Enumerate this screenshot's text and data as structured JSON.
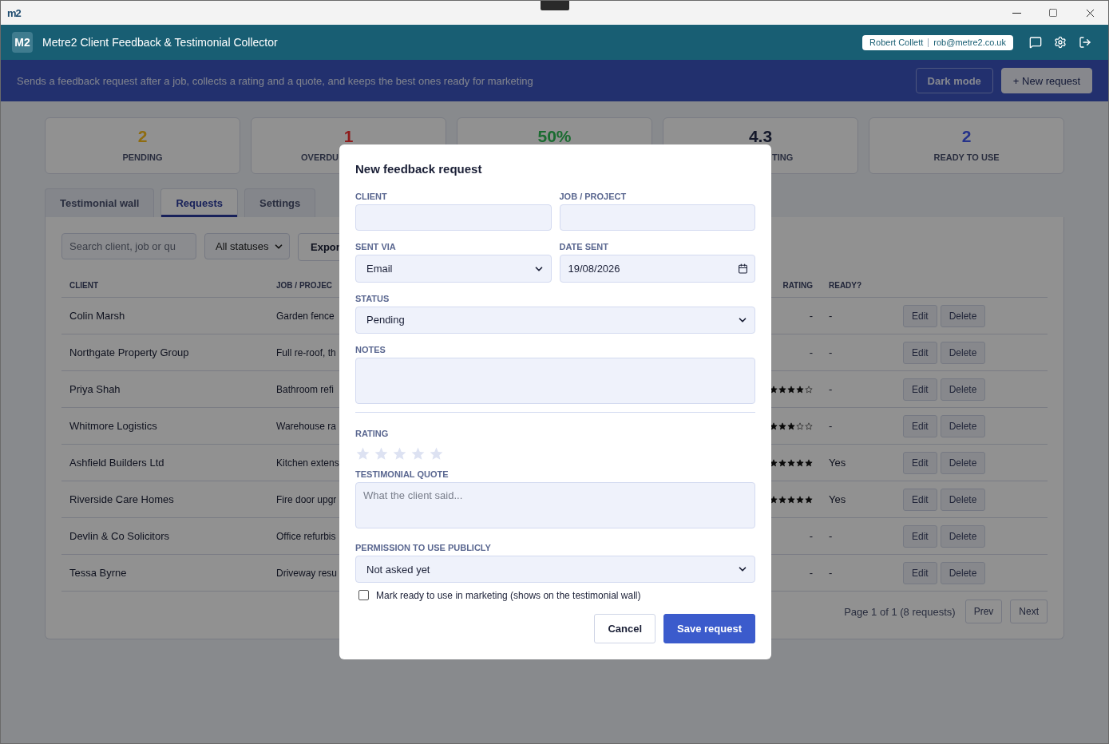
{
  "window": {
    "logo": "m2"
  },
  "header": {
    "logo": "M2",
    "title": "Metre2 Client Feedback & Testimonial Collector",
    "user": {
      "name": "Robert Collett",
      "email": "rob@metre2.co.uk"
    }
  },
  "banner": {
    "text": "Sends a feedback request after a job, collects a rating and a quote, and keeps the best ones ready for marketing",
    "buttons": [
      {
        "label": "Dark mode",
        "kind": "outline"
      },
      {
        "label": "+ New request",
        "kind": "primary"
      }
    ]
  },
  "stats": [
    {
      "value": "2",
      "label": "PENDING",
      "color": "#8f6c10"
    },
    {
      "value": "1",
      "label": "OVERDU",
      "color": "#8e1c1c"
    },
    {
      "value": "50%",
      "color": "#1a6b30"
    },
    {
      "value": "4.3",
      "label": "TING",
      "color": "#15192b"
    },
    {
      "value": "2",
      "label": "READY TO USE",
      "color": "#26338a"
    }
  ],
  "tabs": [
    {
      "label": "Testimonial wall",
      "selected": false
    },
    {
      "label": "Requests",
      "selected": true
    },
    {
      "label": "Settings",
      "selected": false
    }
  ],
  "toolbar": {
    "search_placeholder": "Search client, job or qu",
    "filter": "All statuses",
    "export": "Expor"
  },
  "table": {
    "columns": [
      "CLIENT",
      "JOB / PROJEC",
      "RATING",
      "READY?"
    ],
    "rows": [
      {
        "client": "Colin Marsh",
        "job": "Garden fence",
        "rating": "-",
        "ready": "-",
        "actions": [
          "Edit",
          "Delete"
        ]
      },
      {
        "client": "Northgate Property Group",
        "job": "Full re-roof, th",
        "rating": "-",
        "ready": "-",
        "actions": [
          "Edit",
          "Delete"
        ]
      },
      {
        "client": "Priya Shah",
        "job": "Bathroom refi",
        "stars": 4,
        "ready": "-",
        "actions": [
          "Edit",
          "Delete"
        ]
      },
      {
        "client": "Whitmore Logistics",
        "job": "Warehouse ra",
        "stars": 3,
        "ready": "-",
        "actions": [
          "Edit",
          "Delete"
        ]
      },
      {
        "client": "Ashfield Builders Ltd",
        "job": "Kitchen extens",
        "stars": 5,
        "ready": "Yes",
        "actions": [
          "Edit",
          "Delete"
        ]
      },
      {
        "client": "Riverside Care Homes",
        "job": "Fire door upgr",
        "stars": 5,
        "ready": "Yes",
        "actions": [
          "Edit",
          "Delete"
        ]
      },
      {
        "client": "Devlin & Co Solicitors",
        "job": "Office refurbis",
        "rating": "-",
        "ready": "-",
        "actions": [
          "Edit",
          "Delete"
        ]
      },
      {
        "client": "Tessa Byrne",
        "job": "Driveway resu",
        "rating": "-",
        "ready": "-",
        "actions": [
          "Edit",
          "Delete"
        ]
      }
    ]
  },
  "pagination": {
    "summary": "Page 1 of 1 (8 requests)",
    "prev": "Prev",
    "next": "Next"
  },
  "modal": {
    "title": "New feedback request",
    "client": {
      "label": "CLIENT"
    },
    "job": {
      "label": "JOB / PROJECT"
    },
    "sent_via": {
      "label": "SENT VIA",
      "value": "Email"
    },
    "date_sent": {
      "label": "DATE SENT",
      "value": "19/08/2026"
    },
    "status": {
      "label": "STATUS",
      "value": "Pending"
    },
    "notes": {
      "label": "NOTES"
    },
    "rating": {
      "label": "RATING",
      "stars": 0
    },
    "quote": {
      "label": "TESTIMONIAL QUOTE",
      "placeholder": "What the client said..."
    },
    "permission": {
      "label": "PERMISSION TO USE PUBLICLY",
      "value": "Not asked yet"
    },
    "ready": {
      "label": "Mark ready to use in marketing (shows on the testimonial wall)",
      "checked": false
    },
    "buttons": [
      {
        "label": "Cancel",
        "kind": "secondary"
      },
      {
        "label": "Save request",
        "kind": "primary"
      }
    ]
  }
}
